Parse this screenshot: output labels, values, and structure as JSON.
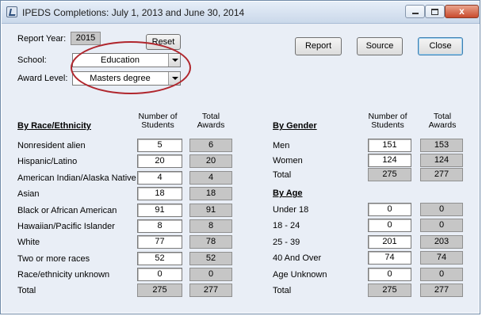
{
  "window": {
    "title": "IPEDS Completions:  July 1, 2013 and June 30, 2014",
    "min_icon": "minimize-icon",
    "max_icon": "maximize-icon",
    "close_glyph": "x"
  },
  "filters": {
    "report_year_label": "Report Year:",
    "report_year": "2015",
    "reset_label": "Reset",
    "school_label": "School:",
    "school_value": "Education",
    "award_level_label": "Award Level:",
    "award_level_value": "Masters degree"
  },
  "buttons": {
    "report": "Report",
    "source": "Source",
    "close": "Close"
  },
  "race": {
    "heading": "By Race/Ethnicity",
    "col_students": "Number of Students",
    "col_awards": "Total Awards",
    "rows": [
      {
        "label": "Nonresident alien",
        "students": "5",
        "awards": "6"
      },
      {
        "label": "Hispanic/Latino",
        "students": "20",
        "awards": "20"
      },
      {
        "label": "American Indian/Alaska Native",
        "students": "4",
        "awards": "4"
      },
      {
        "label": "Asian",
        "students": "18",
        "awards": "18"
      },
      {
        "label": "Black or African American",
        "students": "91",
        "awards": "91"
      },
      {
        "label": "Hawaiian/Pacific Islander",
        "students": "8",
        "awards": "8"
      },
      {
        "label": "White",
        "students": "77",
        "awards": "78"
      },
      {
        "label": "Two or more races",
        "students": "52",
        "awards": "52"
      },
      {
        "label": "Race/ethnicity unknown",
        "students": "0",
        "awards": "0"
      }
    ],
    "total_label": "Total",
    "total_students": "275",
    "total_awards": "277"
  },
  "gender": {
    "heading": "By Gender",
    "col_students": "Number of Students",
    "col_awards": "Total Awards",
    "rows": [
      {
        "label": "Men",
        "students": "151",
        "awards": "153"
      },
      {
        "label": "Women",
        "students": "124",
        "awards": "124"
      }
    ],
    "total_label": "Total",
    "total_students": "275",
    "total_awards": "277"
  },
  "age": {
    "heading": "By Age",
    "rows": [
      {
        "label": "Under 18",
        "students": "0",
        "awards": "0"
      },
      {
        "label": "18 - 24",
        "students": "0",
        "awards": "0"
      },
      {
        "label": "25 - 39",
        "students": "201",
        "awards": "203"
      },
      {
        "label": "40 And Over",
        "students": "74",
        "awards": "74"
      },
      {
        "label": "Age Unknown",
        "students": "0",
        "awards": "0"
      }
    ],
    "total_label": "Total",
    "total_students": "275",
    "total_awards": "277"
  },
  "annotation": {
    "highlight_color": "#b0262d"
  }
}
